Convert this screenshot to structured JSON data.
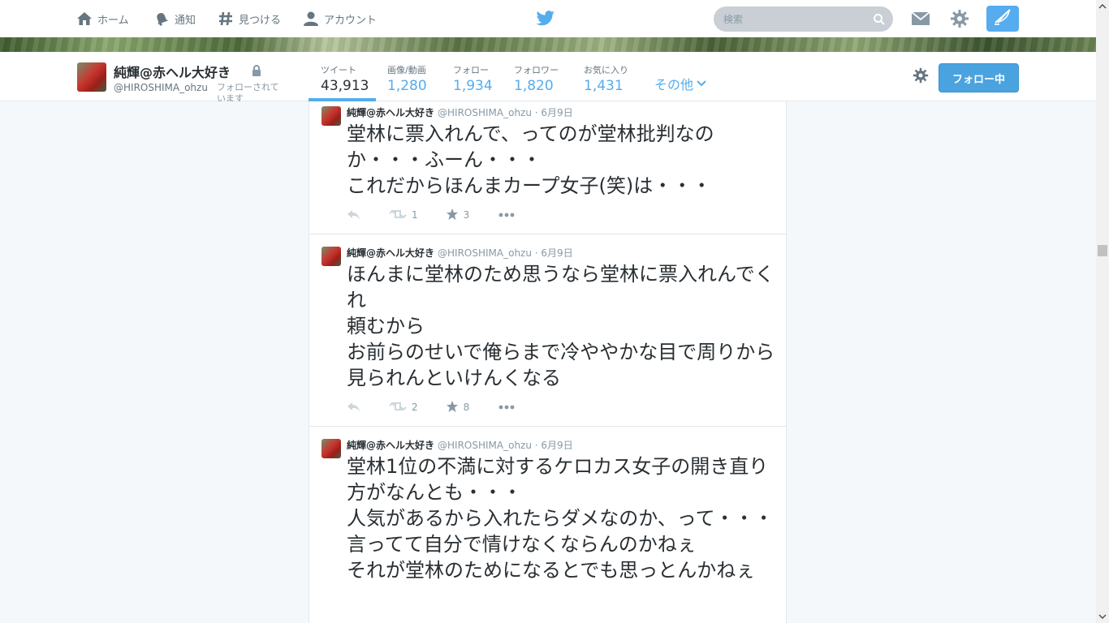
{
  "nav": {
    "home": "ホーム",
    "notifications": "通知",
    "discover": "見つける",
    "account": "アカウント",
    "search_placeholder": "検索"
  },
  "profile": {
    "name": "純輝@赤ヘル大好き",
    "handle": "@HIROSHIMA_ohzu",
    "follows_you": "フォローされています",
    "follow_button": "フォロー中",
    "more": "その他"
  },
  "stats": [
    {
      "label": "ツイート",
      "value": "43,913"
    },
    {
      "label": "画像/動画",
      "value": "1,280"
    },
    {
      "label": "フォロー",
      "value": "1,934"
    },
    {
      "label": "フォロワー",
      "value": "1,820"
    },
    {
      "label": "お気に入り",
      "value": "1,431"
    }
  ],
  "tweets": [
    {
      "name": "純輝@赤ヘル大好き",
      "handle": "@HIROSHIMA_ohzu",
      "date": "· 6月9日",
      "text": "堂林に票入れんで、ってのが堂林批判なのか・・・ふーん・・・\nこれだからほんまカープ女子(笑)は・・・",
      "retweets": "1",
      "favorites": "3"
    },
    {
      "name": "純輝@赤ヘル大好き",
      "handle": "@HIROSHIMA_ohzu",
      "date": "· 6月9日",
      "text": "ほんまに堂林のため思うなら堂林に票入れんでくれ\n頼むから\nお前らのせいで俺らまで冷ややかな目で周りから見られんといけんくなる",
      "retweets": "2",
      "favorites": "8"
    },
    {
      "name": "純輝@赤ヘル大好き",
      "handle": "@HIROSHIMA_ohzu",
      "date": "· 6月9日",
      "text": "堂林1位の不満に対するケロカス女子の開き直り方がなんとも・・・\n人気があるから入れたらダメなのか、って・・・\n言ってて自分で情けなくならんのかねぇ\nそれが堂林のためになるとでも思っとんかねぇ",
      "retweets": "",
      "favorites": ""
    }
  ],
  "colors": {
    "accent": "#55acee",
    "follow_button": "#4aa3df",
    "text": "#292f33",
    "muted": "#8899a6"
  }
}
